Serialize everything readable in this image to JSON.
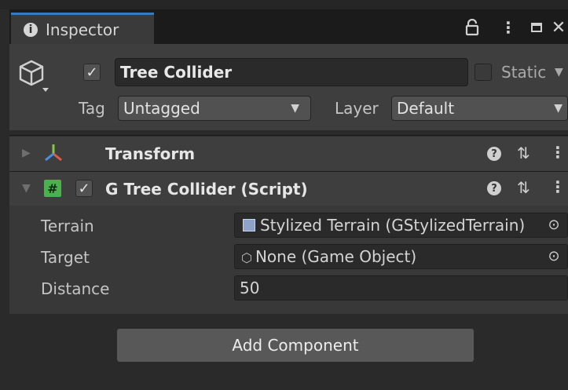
{
  "tab": {
    "title": "Inspector",
    "icon": "info-icon"
  },
  "window_controls": {
    "lock": "lock-icon",
    "menu": "kebab-icon",
    "maximize": "maximize-icon",
    "close": "close-icon"
  },
  "gameobject": {
    "active": true,
    "name": "Tree Collider",
    "static_label": "Static",
    "static_checked": false,
    "tag_label": "Tag",
    "tag_value": "Untagged",
    "layer_label": "Layer",
    "layer_value": "Default"
  },
  "components": [
    {
      "title": "Transform",
      "expanded": false,
      "icon": "transform-axes-icon"
    },
    {
      "title": "G Tree Collider (Script)",
      "expanded": true,
      "enabled": true,
      "icon": "script-hash-icon"
    }
  ],
  "properties": [
    {
      "label": "Terrain",
      "value": "Stylized Terrain (GStylizedTerrain)",
      "icon": "terrain-icon"
    },
    {
      "label": "Target",
      "value": "None (Game Object)",
      "icon": "gameobject-icon"
    },
    {
      "label": "Distance",
      "value": "50"
    }
  ],
  "add_component_label": "Add Component",
  "colors": {
    "accent": "#3a79bb",
    "panel": "#3e3e3e",
    "background": "#2a2a2a",
    "transform_red": "#e05a4a",
    "transform_green": "#8bc34a",
    "transform_blue": "#4a90e2",
    "script_green": "#4caf50"
  }
}
